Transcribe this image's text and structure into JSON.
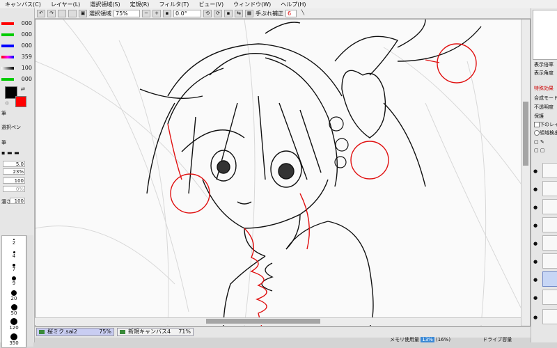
{
  "menu": [
    "キャンバス(C)",
    "レイヤー(L)",
    "選択領域(S)",
    "定規(R)",
    "フィルタ(T)",
    "ビュー(V)",
    "ウィンドウ(W)",
    "ヘルプ(H)"
  ],
  "toolbar": {
    "selection_label": "選択領域",
    "zoom": "75%",
    "rotation": "0.0°",
    "stabilizer_label": "手ぶれ補正",
    "stabilizer_value": "6"
  },
  "left": {
    "colors": [
      {
        "value": "000",
        "color": "#ff0000"
      },
      {
        "value": "000",
        "color": "#00cc00"
      },
      {
        "value": "000",
        "color": "#0000ff"
      },
      {
        "value": "359",
        "color": "#ff00ff"
      },
      {
        "value": "100",
        "color": "#888888"
      },
      {
        "value": "000",
        "color": "#00cc00"
      }
    ],
    "fg_color": "#000000",
    "bg_color": "#ff0000",
    "brush_label": "筆",
    "pen_label": "選択ペン",
    "size_value": "5.0",
    "min_size_value": "23%",
    "density_value": "100",
    "blur_value": "0%",
    "density2_label": "濃さ",
    "density2_value": "100",
    "brush_sizes": [
      "2",
      "4",
      "7",
      "9",
      "20",
      "50",
      "120",
      "350"
    ]
  },
  "tabs": [
    {
      "name": "桜ミク.sai2",
      "percent": "75%"
    },
    {
      "name": "新規キャンバス4",
      "percent": "71%"
    }
  ],
  "status": {
    "memory_label": "メモリ使用量",
    "memory_value": "13%",
    "memory_detail": "(16%)",
    "drive_label": "ドライブ容量"
  },
  "right": {
    "zoom_label": "表示倍率",
    "angle_label": "表示角度",
    "effect_label": "特殊効果",
    "blend_label": "合成モード",
    "opacity_label": "不透明度",
    "protect_label": "保護",
    "lower_label": "下のレイ",
    "area_label": "領域検出"
  }
}
